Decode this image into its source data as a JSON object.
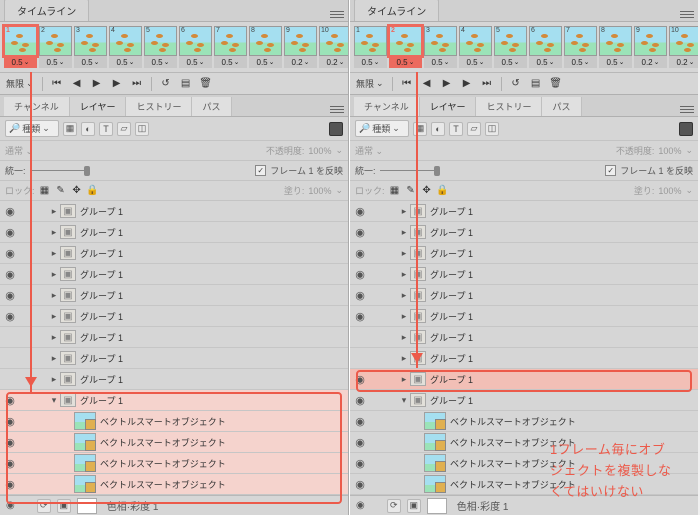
{
  "left": {
    "timeline_tab": "タイムライン",
    "selected_frame_index": 0,
    "frames": [
      {
        "num": "1",
        "dur": "0.5"
      },
      {
        "num": "2",
        "dur": "0.5"
      },
      {
        "num": "3",
        "dur": "0.5"
      },
      {
        "num": "4",
        "dur": "0.5"
      },
      {
        "num": "5",
        "dur": "0.5"
      },
      {
        "num": "6",
        "dur": "0.5"
      },
      {
        "num": "7",
        "dur": "0.5"
      },
      {
        "num": "8",
        "dur": "0.5"
      },
      {
        "num": "9",
        "dur": "0.2"
      },
      {
        "num": "10",
        "dur": "0.2"
      }
    ],
    "loop_label": "無限",
    "tabs2": {
      "channel": "チャンネル",
      "layer": "レイヤー",
      "history": "ヒストリー",
      "path": "パス"
    },
    "filter_label": "種類",
    "blend_label": "通常",
    "opacity_label": "不透明度:",
    "opacity_value": "100%",
    "frame1_label": "フレーム 1 を反映",
    "lock_label": "ロック:",
    "fill_label": "塗り:",
    "fill_value": "100%",
    "groups": [
      {
        "type": "group",
        "name": "グループ 1",
        "indent": 1,
        "eye": true,
        "open": false
      },
      {
        "type": "group",
        "name": "グループ 1",
        "indent": 1,
        "eye": true,
        "open": false
      },
      {
        "type": "group",
        "name": "グループ 1",
        "indent": 1,
        "eye": true,
        "open": false
      },
      {
        "type": "group",
        "name": "グループ 1",
        "indent": 1,
        "eye": true,
        "open": false
      },
      {
        "type": "group",
        "name": "グループ 1",
        "indent": 1,
        "eye": true,
        "open": false
      },
      {
        "type": "group",
        "name": "グループ 1",
        "indent": 1,
        "eye": true,
        "open": false
      },
      {
        "type": "group",
        "name": "グループ 1",
        "indent": 1,
        "eye": false,
        "open": false
      },
      {
        "type": "group",
        "name": "グループ 1",
        "indent": 1,
        "eye": false,
        "open": false
      },
      {
        "type": "group",
        "name": "グループ 1",
        "indent": 1,
        "eye": false,
        "open": false
      },
      {
        "type": "group",
        "name": "グループ 1",
        "indent": 1,
        "eye": true,
        "open": true,
        "hl": true
      },
      {
        "type": "smart",
        "name": "ベクトルスマートオブジェクト",
        "indent": 2,
        "eye": true,
        "hl": true
      },
      {
        "type": "smart",
        "name": "ベクトルスマートオブジェクト",
        "indent": 2,
        "eye": true,
        "hl": true
      },
      {
        "type": "smart",
        "name": "ベクトルスマートオブジェクト",
        "indent": 2,
        "eye": true,
        "hl": true
      },
      {
        "type": "smart",
        "name": "ベクトルスマートオブジェクト",
        "indent": 2,
        "eye": true,
        "hl": true
      }
    ],
    "hue_layer": "色相·彩度 1"
  },
  "right": {
    "timeline_tab": "タイムライン",
    "selected_frame_index": 1,
    "frames": [
      {
        "num": "1",
        "dur": "0.5"
      },
      {
        "num": "2",
        "dur": "0.5"
      },
      {
        "num": "3",
        "dur": "0.5"
      },
      {
        "num": "4",
        "dur": "0.5"
      },
      {
        "num": "5",
        "dur": "0.5"
      },
      {
        "num": "6",
        "dur": "0.5"
      },
      {
        "num": "7",
        "dur": "0.5"
      },
      {
        "num": "8",
        "dur": "0.5"
      },
      {
        "num": "9",
        "dur": "0.2"
      },
      {
        "num": "10",
        "dur": "0.2"
      }
    ],
    "loop_label": "無限",
    "tabs2": {
      "channel": "チャンネル",
      "layer": "レイヤー",
      "history": "ヒストリー",
      "path": "パス"
    },
    "filter_label": "種類",
    "blend_label": "通常",
    "opacity_label": "不透明度:",
    "opacity_value": "100%",
    "frame1_label": "フレーム 1 を反映",
    "lock_label": "ロック:",
    "fill_label": "塗り:",
    "fill_value": "100%",
    "groups": [
      {
        "type": "group",
        "name": "グループ 1",
        "indent": 1,
        "eye": true,
        "open": false
      },
      {
        "type": "group",
        "name": "グループ 1",
        "indent": 1,
        "eye": true,
        "open": false
      },
      {
        "type": "group",
        "name": "グループ 1",
        "indent": 1,
        "eye": true,
        "open": false
      },
      {
        "type": "group",
        "name": "グループ 1",
        "indent": 1,
        "eye": true,
        "open": false
      },
      {
        "type": "group",
        "name": "グループ 1",
        "indent": 1,
        "eye": true,
        "open": false
      },
      {
        "type": "group",
        "name": "グループ 1",
        "indent": 1,
        "eye": true,
        "open": false
      },
      {
        "type": "group",
        "name": "グループ 1",
        "indent": 1,
        "eye": false,
        "open": false
      },
      {
        "type": "group",
        "name": "グループ 1",
        "indent": 1,
        "eye": false,
        "open": false
      },
      {
        "type": "group",
        "name": "グループ 1",
        "indent": 1,
        "eye": true,
        "open": false,
        "hl": true,
        "hlstrong": true
      },
      {
        "type": "group",
        "name": "グループ 1",
        "indent": 1,
        "eye": true,
        "open": true
      },
      {
        "type": "smart",
        "name": "ベクトルスマートオブジェクト",
        "indent": 2,
        "eye": true
      },
      {
        "type": "smart",
        "name": "ベクトルスマートオブジェクト",
        "indent": 2,
        "eye": true
      },
      {
        "type": "smart",
        "name": "ベクトルスマートオブジェクト",
        "indent": 2,
        "eye": true
      },
      {
        "type": "smart",
        "name": "ベクトルスマートオブジェクト",
        "indent": 2,
        "eye": true
      }
    ],
    "hue_layer": "色相·彩度 1"
  },
  "annotation": {
    "line1": "1フレーム毎にオブ",
    "line2": "ジェクトを複製しな",
    "line3": "くてはいけない"
  },
  "icons": {
    "chev": "⌄",
    "eye": "◉"
  }
}
